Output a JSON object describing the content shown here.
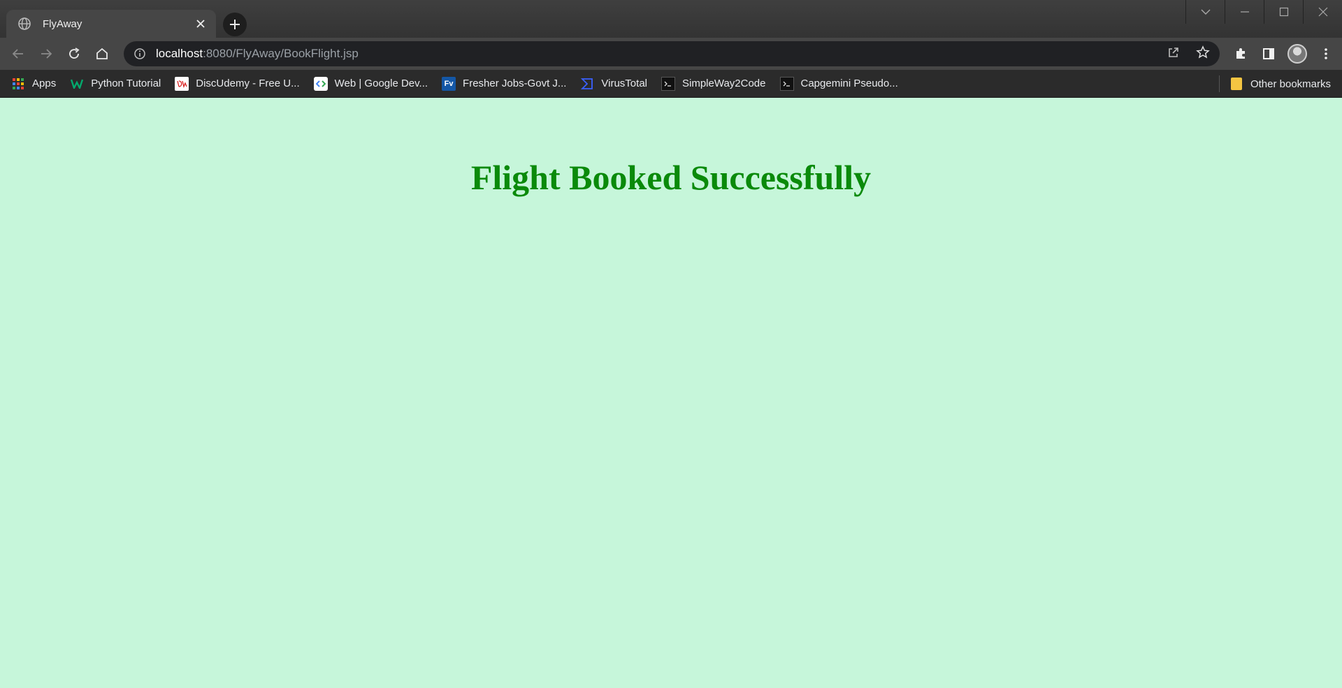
{
  "browser": {
    "tab": {
      "title": "FlyAway",
      "icon": "globe-icon"
    },
    "address": {
      "host": "localhost",
      "rest": ":8080/FlyAway/BookFlight.jsp"
    },
    "bookmarks": [
      {
        "label": "Apps",
        "icon": "apps-grid-icon"
      },
      {
        "label": "Python Tutorial",
        "icon": "w3schools-icon"
      },
      {
        "label": "DiscUdemy - Free U...",
        "icon": "discudemy-icon"
      },
      {
        "label": "Web  |  Google Dev...",
        "icon": "google-dev-icon"
      },
      {
        "label": "Fresher Jobs-Govt J...",
        "icon": "fv-icon",
        "favtext": "Fv"
      },
      {
        "label": "VirusTotal",
        "icon": "virustotal-icon"
      },
      {
        "label": "SimpleWay2Code",
        "icon": "terminal-icon"
      },
      {
        "label": "Capgemini Pseudo...",
        "icon": "terminal-icon"
      }
    ],
    "other_bookmarks": "Other bookmarks"
  },
  "page": {
    "heading": "Flight Booked Successfully",
    "background": "#c6f6da",
    "heading_color": "#0a8a0a"
  }
}
